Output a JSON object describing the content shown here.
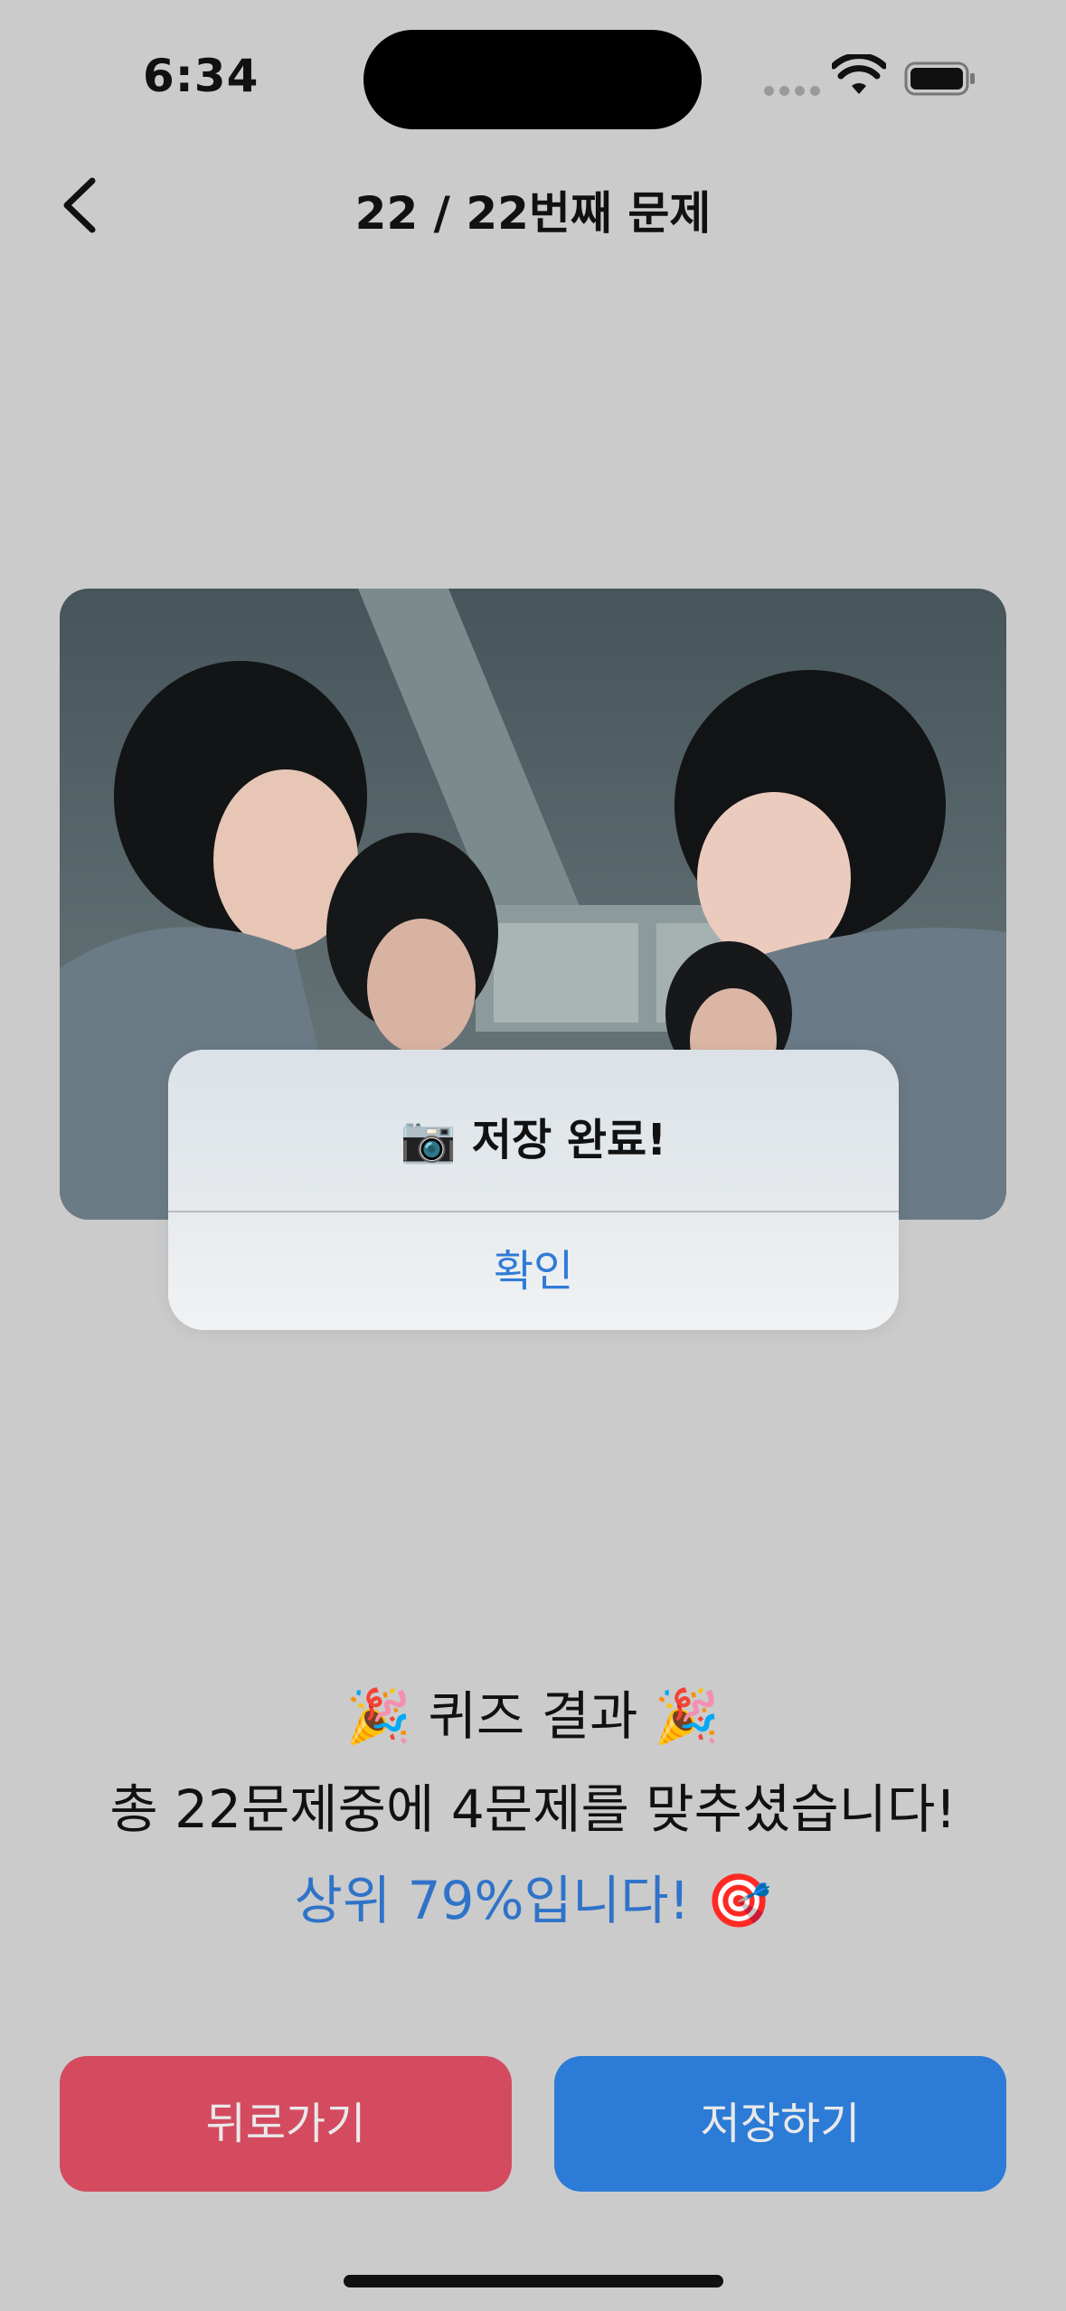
{
  "status": {
    "time": "6:34"
  },
  "nav": {
    "title": "22 / 22번째 문제"
  },
  "alert": {
    "icon": "📷",
    "title": "저장 완료!",
    "confirm_label": "확인"
  },
  "result": {
    "title_emoji": "🎉",
    "title": "퀴즈 결과",
    "summary": "총 22문제중에 4문제를 맞추셨습니다!",
    "rank": "상위 79%입니다!",
    "rank_emoji": "🎯"
  },
  "buttons": {
    "back_label": "뒤로가기",
    "save_label": "저장하기"
  },
  "colors": {
    "back": "#d44b60",
    "save": "#2c7bd6",
    "accent_text": "#2f73c9",
    "background": "#cbcbcb"
  }
}
